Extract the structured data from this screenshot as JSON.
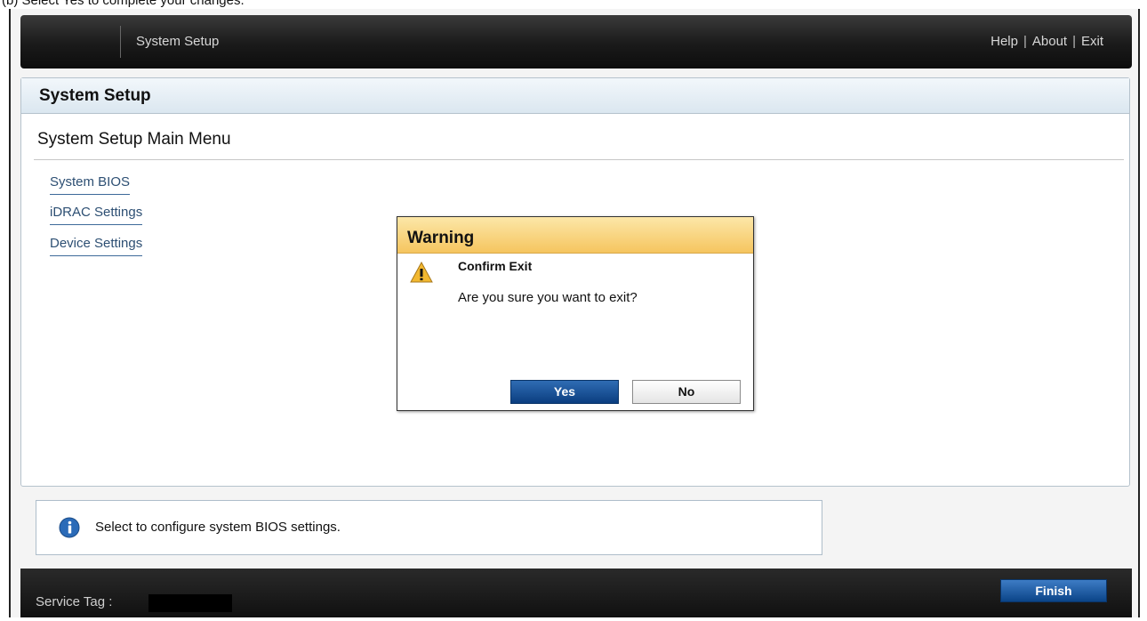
{
  "caption": "(b) Select Yes to complete your changes.",
  "header": {
    "title": "System Setup",
    "links": {
      "help": "Help",
      "about": "About",
      "exit": "Exit",
      "separator": "|"
    }
  },
  "panel": {
    "title": "System Setup",
    "menu_title": "System Setup Main Menu",
    "menu_items": [
      {
        "label": "System BIOS"
      },
      {
        "label": "iDRAC Settings"
      },
      {
        "label": "Device Settings"
      }
    ]
  },
  "dialog": {
    "title": "Warning",
    "subject": "Confirm Exit",
    "message": "Are you sure you want to exit?",
    "yes_label": "Yes",
    "no_label": "No",
    "icon": "warning-icon"
  },
  "help": {
    "icon": "info-icon",
    "text": "Select to configure system BIOS settings."
  },
  "footer": {
    "service_tag_label": "Service Tag :",
    "service_tag_value": "",
    "finish_label": "Finish"
  },
  "colors": {
    "dialog_header": "#f5c55f",
    "primary_button": "#0b3e80",
    "link": "#2d4f73"
  }
}
